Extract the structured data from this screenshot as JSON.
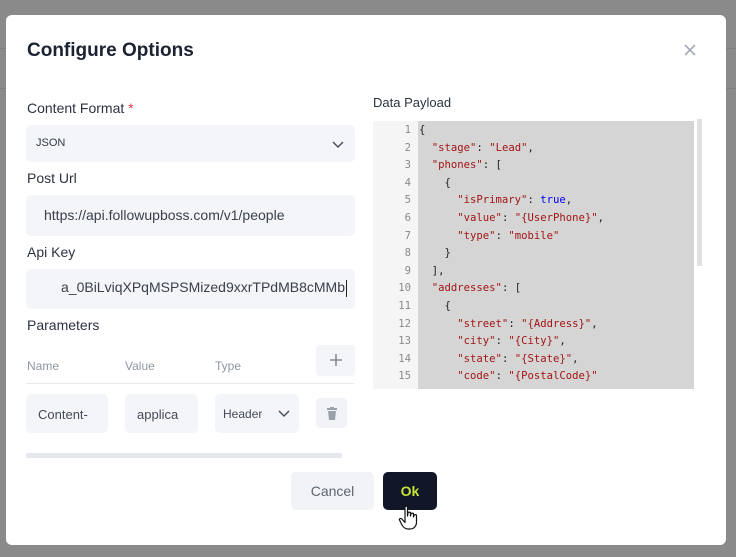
{
  "dialog": {
    "title": "Configure Options",
    "close_icon": "close-icon"
  },
  "form": {
    "content_format": {
      "label": "Content Format",
      "required_mark": "*",
      "value": "JSON",
      "icon": "chevron-down-icon"
    },
    "post_url": {
      "label": "Post Url",
      "value": "https://api.followupboss.com/v1/people"
    },
    "api_key": {
      "label": "Api Key",
      "value": "a_0BiLviqXPqMSPSMized9xxrTPdMB8cMMb"
    },
    "parameters": {
      "label": "Parameters",
      "columns": [
        "Name",
        "Value",
        "Type"
      ],
      "add_icon": "plus-icon",
      "rows": [
        {
          "name": "Content-",
          "value": "applica",
          "type": "Header",
          "delete_icon": "trash-icon"
        }
      ]
    }
  },
  "payload": {
    "label": "Data Payload",
    "lines": [
      {
        "n": "1",
        "text": "{"
      },
      {
        "n": "2",
        "text": "  \"stage\": \"Lead\","
      },
      {
        "n": "3",
        "text": "  \"phones\": ["
      },
      {
        "n": "4",
        "text": "    {"
      },
      {
        "n": "5",
        "text": "      \"isPrimary\": true,"
      },
      {
        "n": "6",
        "text": "      \"value\": \"{UserPhone}\","
      },
      {
        "n": "7",
        "text": "      \"type\": \"mobile\""
      },
      {
        "n": "8",
        "text": "    }"
      },
      {
        "n": "9",
        "text": "  ],"
      },
      {
        "n": "10",
        "text": "  \"addresses\": ["
      },
      {
        "n": "11",
        "text": "    {"
      },
      {
        "n": "12",
        "text": "      \"street\": \"{Address}\","
      },
      {
        "n": "13",
        "text": "      \"city\": \"{City}\","
      },
      {
        "n": "14",
        "text": "      \"state\": \"{State}\","
      },
      {
        "n": "15",
        "text": "      \"code\": \"{PostalCode}\""
      }
    ]
  },
  "footer": {
    "cancel_label": "Cancel",
    "ok_label": "Ok"
  },
  "colors": {
    "ok_bg": "#111729",
    "ok_text": "#c7e33a",
    "required": "#e0364e"
  }
}
